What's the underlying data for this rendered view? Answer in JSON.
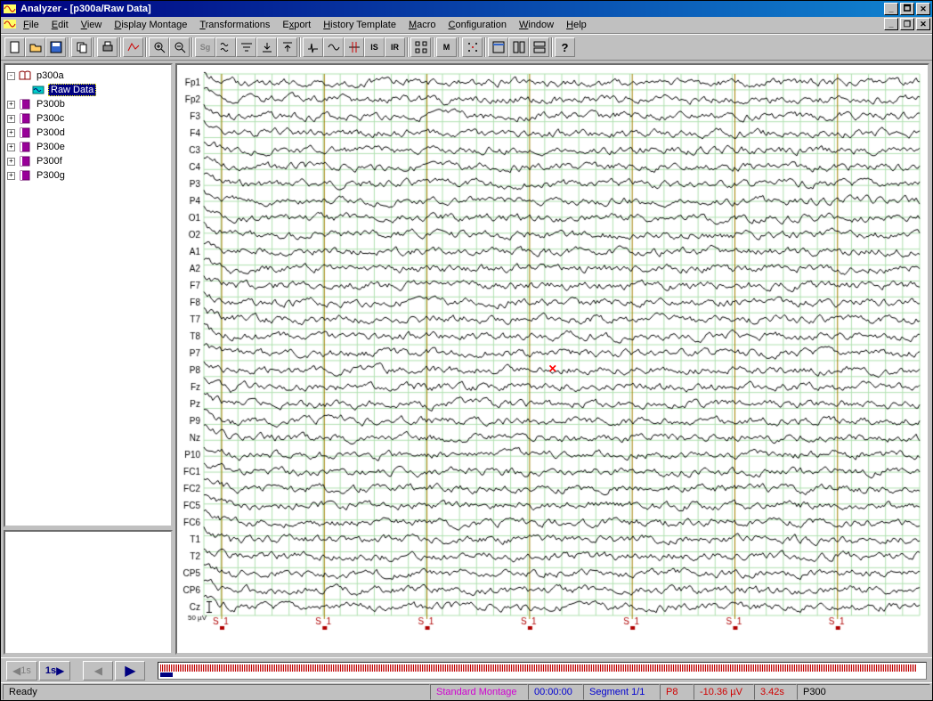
{
  "title": "Analyzer - [p300a/Raw Data]",
  "menus": [
    "File",
    "Edit",
    "View",
    "Display Montage",
    "Transformations",
    "Export",
    "History Template",
    "Macro",
    "Configuration",
    "Window",
    "Help"
  ],
  "menu_accel_idx": [
    0,
    0,
    0,
    0,
    0,
    1,
    0,
    0,
    0,
    0,
    0
  ],
  "toolbar_groups": [
    [
      "new",
      "open",
      "save"
    ],
    [
      "copy"
    ],
    [
      "print"
    ],
    [
      "plot-toggle"
    ],
    [
      "zoom-in",
      "zoom-out"
    ],
    [
      "sg",
      "waves",
      "filter",
      "marker-down",
      "marker-up"
    ],
    [
      "pulse1",
      "pulse2",
      "cut",
      "IS",
      "IR"
    ],
    [
      "grid"
    ],
    [
      "M"
    ],
    [
      "dots"
    ],
    [
      "win1",
      "win2",
      "win3"
    ],
    [
      "help"
    ]
  ],
  "toolbar_labels": {
    "sg": "Sg",
    "IS": "IS",
    "IR": "IR",
    "M": "M",
    "help": "?"
  },
  "tree": {
    "root": {
      "label": "p300a",
      "icon": "book-open",
      "expanded": true
    },
    "selected_child": {
      "label": "Raw Data",
      "icon": "dataset"
    },
    "siblings": [
      {
        "label": "P300b",
        "expandable": true
      },
      {
        "label": "P300c",
        "expandable": true
      },
      {
        "label": "P300d",
        "expandable": true
      },
      {
        "label": "P300e",
        "expandable": true
      },
      {
        "label": "P300f",
        "expandable": true
      },
      {
        "label": "P300g",
        "expandable": true
      }
    ]
  },
  "channels": [
    "Fp1",
    "Fp2",
    "F3",
    "F4",
    "C3",
    "C4",
    "P3",
    "P4",
    "O1",
    "O2",
    "A1",
    "A2",
    "F7",
    "F8",
    "T7",
    "T8",
    "P7",
    "P8",
    "Fz",
    "Pz",
    "P9",
    "Nz",
    "P10",
    "FC1",
    "FC2",
    "FC5",
    "FC6",
    "T1",
    "T2",
    "CP5",
    "CP6",
    "Cz"
  ],
  "scale_label": "50 µV",
  "markers": {
    "label": "S  1",
    "count": 7
  },
  "nav": {
    "back_label": "1s",
    "fwd_label": "1s"
  },
  "status": {
    "ready": "Ready",
    "montage": "Standard Montage",
    "time": "00:00:00",
    "segment": "Segment 1/1",
    "channel": "P8",
    "value": "-10.36 µV",
    "tpos": "3.42s",
    "dataset": "P300"
  },
  "chart_data": {
    "type": "line",
    "description": "Multichannel EEG time-series viewer. 32 channels stacked vertically, each showing continuous voltage over ~7 s with 7 evenly spaced 'S 1' stimulus markers along the bottom. Amplitude scale bar indicates 50 µV. A red cursor 'x' is on channel P8 at t≈3.42 s, value −10.36 µV (from status bar).",
    "x_unit": "s",
    "y_unit": "µV",
    "x_range": [
      0,
      7
    ],
    "scale_uV": 50,
    "cursor": {
      "channel": "P8",
      "t": 3.42,
      "value": -10.36
    },
    "marker_label": "S  1",
    "marker_positions_s": [
      0.2,
      1.33,
      2.46,
      3.59,
      4.72,
      5.85,
      6.98
    ],
    "channels": [
      "Fp1",
      "Fp2",
      "F3",
      "F4",
      "C3",
      "C4",
      "P3",
      "P4",
      "O1",
      "O2",
      "A1",
      "A2",
      "F7",
      "F8",
      "T7",
      "T8",
      "P7",
      "P8",
      "Fz",
      "Pz",
      "P9",
      "Nz",
      "P10",
      "FC1",
      "FC2",
      "FC5",
      "FC6",
      "T1",
      "T2",
      "CP5",
      "CP6",
      "Cz"
    ]
  }
}
